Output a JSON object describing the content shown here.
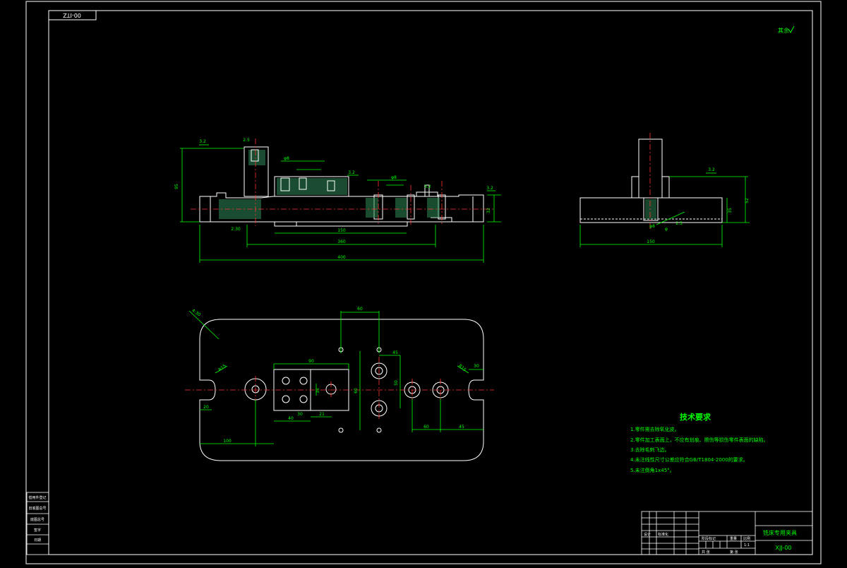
{
  "drawing": {
    "number_box": "00-ITZ",
    "roughness_note": "其余",
    "title": "铣床专用夹具",
    "code": "XJJ-00"
  },
  "dimensions": {
    "front_view": [
      "3.2",
      "95",
      "2.5",
      "3.2",
      "φ8",
      "φ8",
      "3.2",
      "3.2",
      "150",
      "360",
      "400",
      "2:30",
      "32"
    ],
    "side_view": [
      "3.2",
      "52",
      "35",
      "φ8",
      "2.5",
      "φ",
      "150"
    ],
    "plan_view": [
      "4:30",
      "60",
      "90",
      "45",
      "40",
      "30",
      "21",
      "35",
      "60",
      "50",
      "60",
      "100",
      "45",
      "R15",
      "R15",
      "30",
      "20"
    ]
  },
  "tech_requirements": {
    "heading": "技术要求",
    "items": [
      "1.零件需去除氧化皮。",
      "2.零件加工表面上，不应有划痕、擦伤等损伤零件表面的缺陷。",
      "3.去除毛刺飞边。",
      "4.未注线性尺寸公差应符合GB/T1804-2000的要求。",
      "5.未注倒角1x45°。"
    ]
  },
  "left_column": [
    "借用件登记",
    "旧底图总号",
    "底图总号",
    "签字",
    "日期"
  ],
  "title_block": {
    "label_design": "设计",
    "label_standard": "标准化",
    "label_stage": "阶段标记",
    "label_weight": "重量",
    "label_scale": "比例",
    "scale": "1:1",
    "label_sheets": "共 张",
    "label_sheet": "第 张"
  },
  "colors": {
    "outline": "#ffffff",
    "dimension": "#00ff00",
    "center": "#ff3333",
    "hatch": "#2e8b57"
  }
}
